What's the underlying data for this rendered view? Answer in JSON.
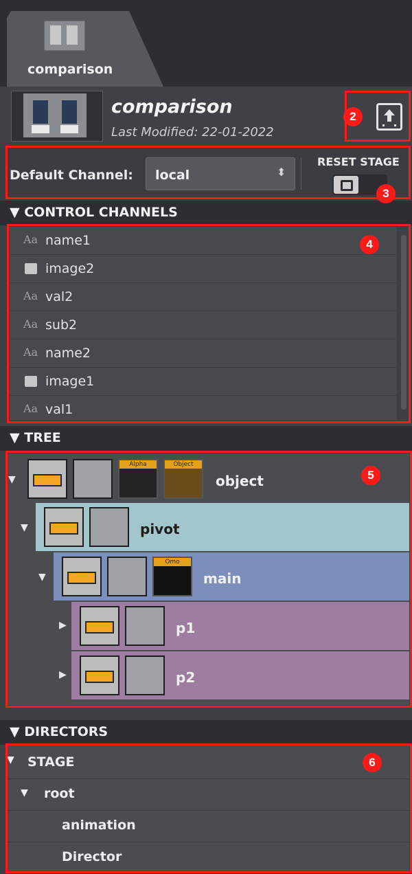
{
  "tab": {
    "label": "comparison"
  },
  "header": {
    "title": "comparison",
    "last_modified": "Last Modified: 22-01-2022"
  },
  "channel": {
    "label": "Default Channel:",
    "value": "local",
    "reset_stage_label": "RESET STAGE"
  },
  "sections": {
    "control_channels": "CONTROL CHANNELS",
    "tree": "TREE",
    "directors": "DIRECTORS"
  },
  "control_channels": [
    {
      "icon": "text-icon",
      "label": "name1"
    },
    {
      "icon": "image-icon",
      "label": "image2"
    },
    {
      "icon": "text-icon",
      "label": "val2"
    },
    {
      "icon": "text-icon",
      "label": "sub2"
    },
    {
      "icon": "text-icon",
      "label": "name2"
    },
    {
      "icon": "image-icon",
      "label": "image1"
    },
    {
      "icon": "text-icon",
      "label": "val1"
    }
  ],
  "text_icon_glyph": "Aa",
  "tree": {
    "object": {
      "label": "object",
      "alpha_badge": "Alpha",
      "object_badge": "Object"
    },
    "pivot": {
      "label": "pivot"
    },
    "main": {
      "label": "main",
      "omo_badge": "Omo"
    },
    "p1": {
      "label": "p1"
    },
    "p2": {
      "label": "p2"
    }
  },
  "directors": {
    "stage": "STAGE",
    "root": "root",
    "animation": "animation",
    "director": "Director"
  },
  "annotations": [
    "2",
    "3",
    "4",
    "5",
    "6"
  ],
  "colors": {
    "annotation_red": "#ff1a1a",
    "pivot_row": "#a3c5cc",
    "main_row": "#7c8fbb",
    "p_row": "#9e7ea0",
    "container_bar": "#f5a623"
  }
}
